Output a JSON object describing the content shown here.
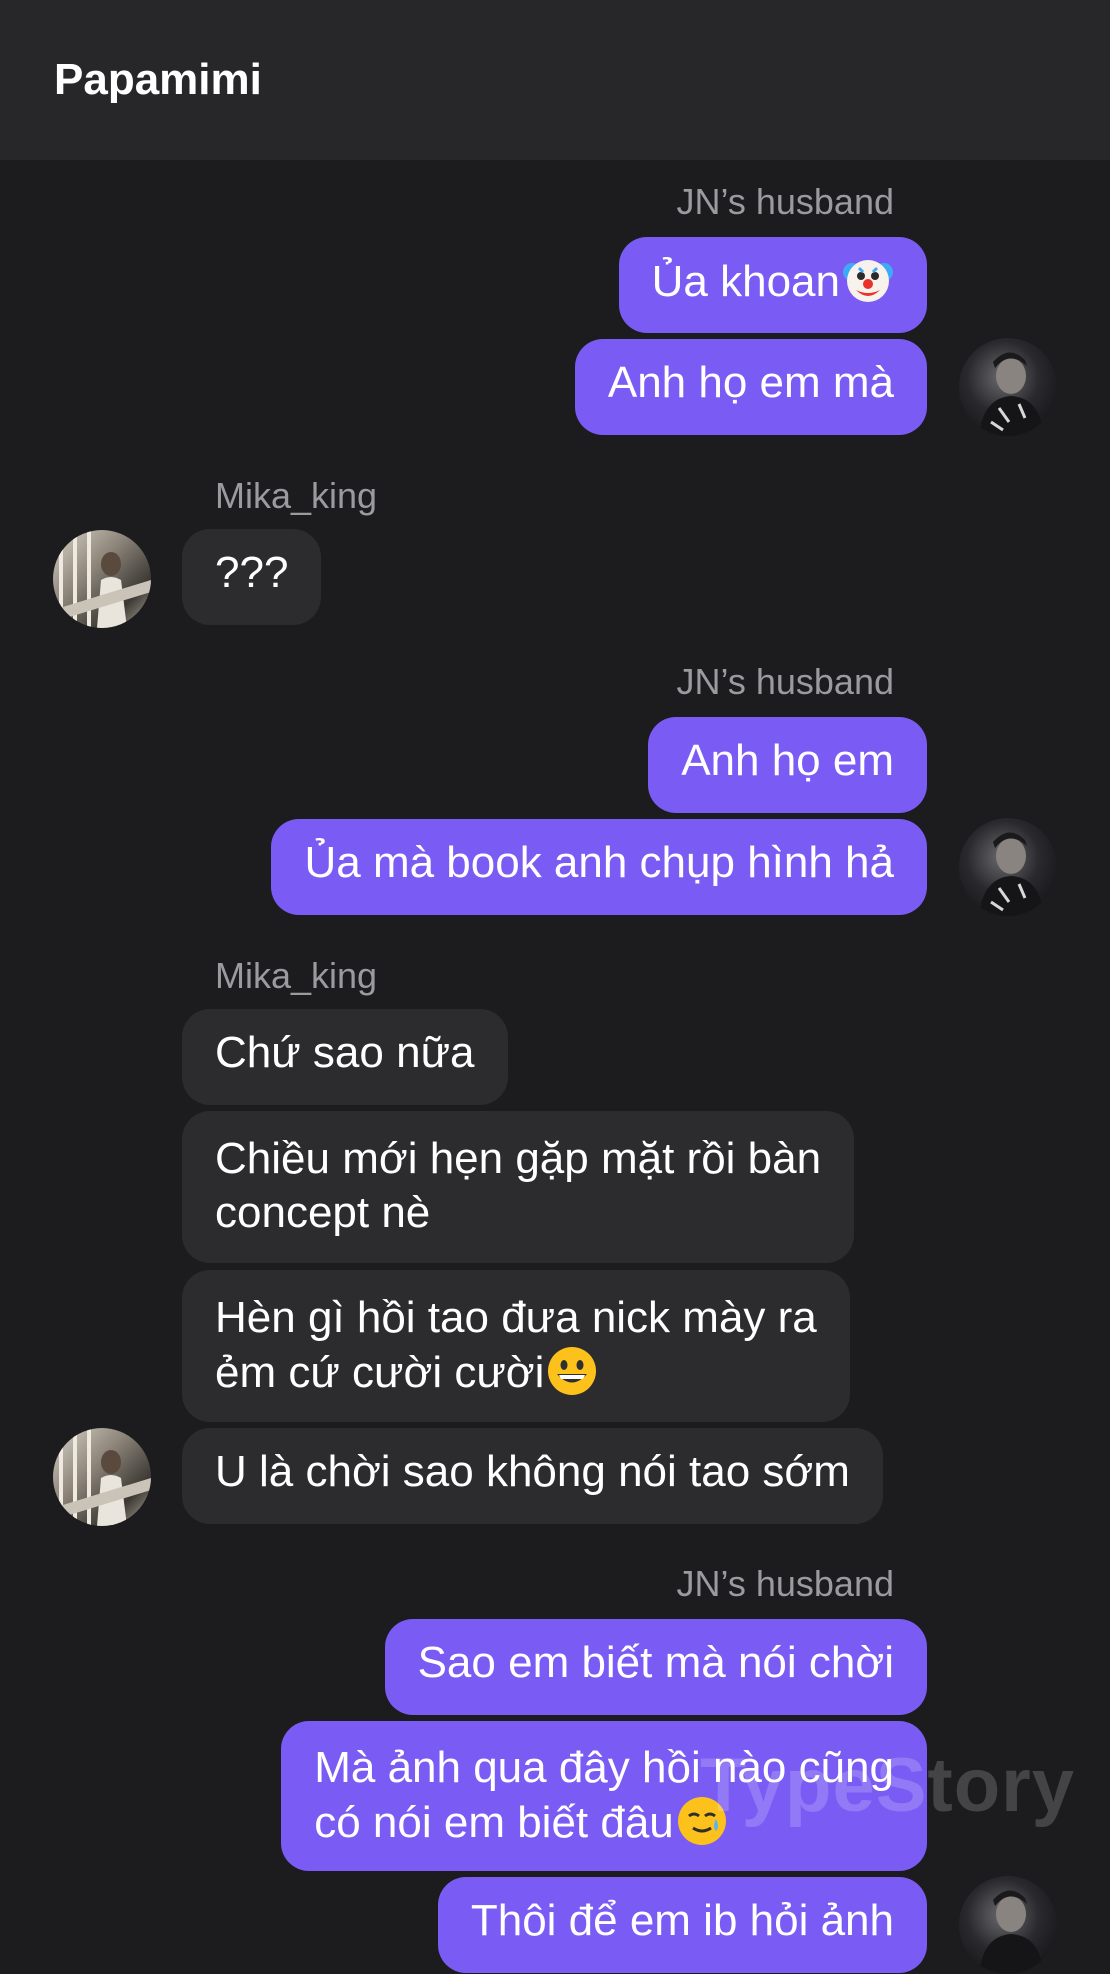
{
  "header": {
    "title": "Papamimi"
  },
  "messages": {
    "s1_sender": "JN’s husband",
    "m1": "Ủa khoan",
    "m2": "Anh họ em mà",
    "s2_sender": "Mika_king",
    "m3": "???",
    "s3_sender": "JN’s husband",
    "m4": "Anh họ em",
    "m5": "Ủa mà book anh chụp hình hả",
    "s4_sender": "Mika_king",
    "m6": "Chứ sao nữa",
    "m7_line1": "Chiều mới hẹn gặp mặt rồi bàn",
    "m7_line2": "concept nè",
    "m8_line1": "Hèn gì hồi tao đưa nick mày ra",
    "m8_line2": "ẻm cứ cười cười",
    "m9": "U là chời sao không nói tao sớm",
    "s5_sender": "JN’s husband",
    "m10": "Sao em biết mà nói chời",
    "m11_line1": "Mà ảnh qua đây hồi nào cũng",
    "m11_line2": "có nói em biết đâu",
    "m12": "Thôi để em ib hỏi ảnh"
  },
  "icons": {
    "clown": "clown-face-emoji",
    "grin": "grinning-face-emoji",
    "tear": "smiling-face-with-tear-emoji"
  },
  "watermark": "TypeStory",
  "colors": {
    "outgoing_bubble": "#7a5cf5",
    "incoming_bubble": "#2c2c2e",
    "background": "#1c1c1e",
    "header": "#27272a",
    "sender_label": "#9a9a9f"
  }
}
